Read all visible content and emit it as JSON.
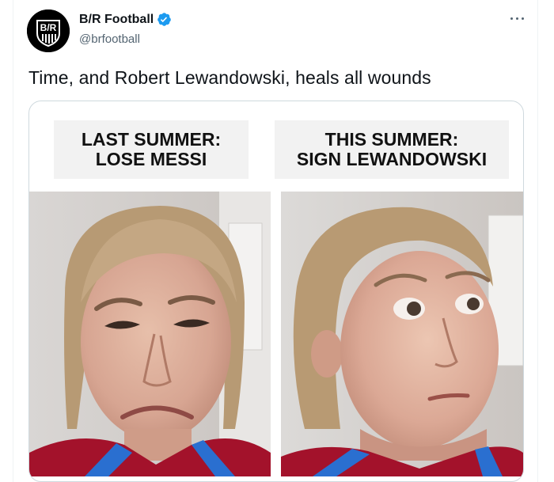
{
  "tweet": {
    "author": {
      "display_name": "B/R Football",
      "handle": "@brfootball",
      "verified": true,
      "avatar_logo_text": "B/R"
    },
    "text": "Time, and Robert Lewandowski, heals all wounds",
    "more_icon": "more-dots-icon"
  },
  "meme": {
    "left_caption": "LAST SUMMER:\nLOSE MESSI",
    "right_caption": "THIS SUMMER:\nSIGN LEWANDOWSKI",
    "left_expression": "disgusted",
    "right_expression": "intrigued"
  },
  "colors": {
    "verified_blue": "#1d9bf0",
    "text_primary": "#0f1419",
    "text_secondary": "#536471",
    "shirt_blue": "#2a6fd0",
    "shirt_red": "#a3122b"
  }
}
